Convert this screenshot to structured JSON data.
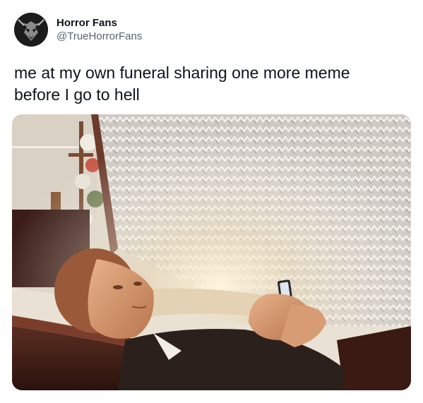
{
  "author": {
    "display_name": "Horror Fans",
    "handle": "@TrueHorrorFans",
    "avatar_icon": "skull-avatar-icon"
  },
  "tweet": {
    "text": "me at my own funeral sharing one more meme\nbefore I go to hell"
  },
  "media": {
    "type": "photo",
    "depicts": "man-lying-in-coffin-holding-phone"
  },
  "colors": {
    "text_primary": "#0f1419",
    "text_secondary": "#536471",
    "background": "#ffffff"
  }
}
